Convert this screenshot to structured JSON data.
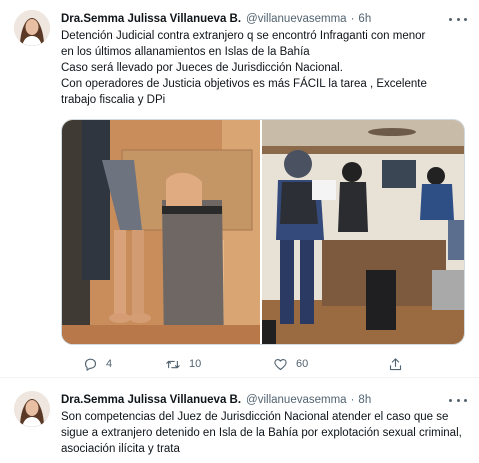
{
  "tweets": [
    {
      "author_name": "Dra.Semma Julissa Villanueva B.",
      "handle": "@villanuevasemma",
      "separator": "·",
      "time": "6h",
      "lines": [
        "Detención Judicial  contra  extranjero q se encontró Infraganti  con menor",
        "en los últimos allanamientos en Islas de la Bahía",
        "Caso será llevado por Jueces de Jurisdicción Nacional.",
        "Con operadores de Justicia objetivos es más FÁCIL la tarea , Excelente",
        "trabajo fiscalia y DPi"
      ],
      "media": [
        {
          "icon": "photo-detained-person"
        },
        {
          "icon": "photo-police-officers"
        }
      ],
      "actions": {
        "reply_count": "4",
        "retweet_count": "10",
        "like_count": "60"
      }
    },
    {
      "author_name": "Dra.Semma Julissa Villanueva B.",
      "handle": "@villanuevasemma",
      "separator": "·",
      "time": "8h",
      "lines": [
        "Son competencias del Juez de Jurisdicción Nacional atender el caso que se sigue a extranjero detenido en Isla de la Bahía por explotación sexual criminal, asociación ilícita y trata"
      ]
    }
  ],
  "colors": {
    "text": "#0f1419",
    "muted": "#536471",
    "divider": "#eff3f4",
    "media_border": "#cfd9de"
  }
}
